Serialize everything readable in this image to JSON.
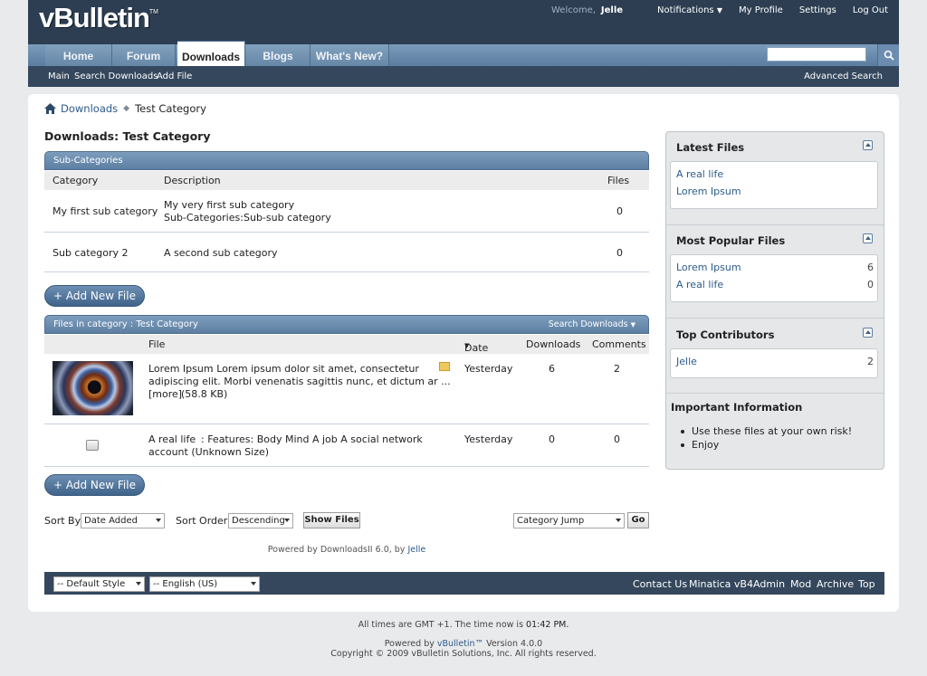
{
  "header": {
    "logo": "vBulletin",
    "logo_tm": "TM",
    "welcome": "Welcome,",
    "username": "Jelle",
    "links": {
      "notifications": "Notifications",
      "my_profile": "My Profile",
      "settings": "Settings",
      "logout": "Log Out"
    }
  },
  "nav": {
    "tabs": [
      "Home",
      "Forum",
      "Downloads",
      "Blogs",
      "What's New?"
    ],
    "active_tab": "Downloads",
    "subnav": [
      "Main",
      "Search Downloads",
      "Add File"
    ],
    "advanced_search": "Advanced Search",
    "search_placeholder": ""
  },
  "breadcrumb": {
    "root": "Downloads",
    "current": "Test Category"
  },
  "page_title": "Downloads: Test Category",
  "subcategories": {
    "header": "Sub-Categories",
    "columns": {
      "category": "Category",
      "description": "Description",
      "files": "Files"
    },
    "rows": [
      {
        "name": "My first sub category",
        "description": "My very first sub category",
        "subcat_label": "Sub-Categories:",
        "subcat_link": "Sub-sub category",
        "files": "0"
      },
      {
        "name": "Sub category 2",
        "description": "A second sub category",
        "files": "0"
      }
    ]
  },
  "add_file_label": "+ Add New File",
  "files": {
    "header": "Files in category : Test Category",
    "search_label": "Search Downloads",
    "columns": {
      "file": "File",
      "date": "Date",
      "downloads": "Downloads",
      "comments": "Comments"
    },
    "rows": [
      {
        "title": "Lorem Ipsum",
        "line1": " : Lorem ipsum dolor sit amet, consectetur",
        "line2": "adipiscing elit. Morbi venenatis sagittis nunc, et dictum ar ...",
        "more": "[more]",
        "size": " (58.8 KB)",
        "date": "Yesterday",
        "downloads": "6",
        "comments": "2"
      },
      {
        "title": "A real life",
        "line1": " : Features: Body Mind A job A social network",
        "line2": "account (Unknown Size)",
        "date": "Yesterday",
        "downloads": "0",
        "comments": "0"
      }
    ]
  },
  "sort": {
    "sort_by_label": "Sort By",
    "sort_by_value": "Date Added",
    "sort_order_label": "Sort Order",
    "sort_order_value": "Descending",
    "show_files": "Show Files",
    "category_jump": "Category Jump",
    "go": "Go"
  },
  "powered_by": {
    "text": "Powered by DownloadsII 6.0, by",
    "author": "Jelle"
  },
  "footer": {
    "style_select": "-- Default Style",
    "language_select": "-- English (US)",
    "links": [
      "Contact Us",
      "Minatica vB4",
      "Admin",
      "Mod",
      "Archive",
      "Top"
    ]
  },
  "bottom": {
    "time_prefix": "All times are GMT +1. The time now is",
    "time_value": "01:42 PM.",
    "powered_prefix": "Powered by",
    "powered_link": "vBulletin™",
    "powered_suffix": "Version 4.0.0",
    "copyright": "Copyright © 2009 vBulletin Solutions, Inc. All rights reserved."
  },
  "sidebar": {
    "latest": {
      "title": "Latest Files",
      "items": [
        "A real life",
        "Lorem Ipsum"
      ]
    },
    "popular": {
      "title": "Most Popular Files",
      "items": [
        {
          "name": "Lorem Ipsum",
          "count": "6"
        },
        {
          "name": "A real life",
          "count": "0"
        }
      ]
    },
    "contributors": {
      "title": "Top Contributors",
      "items": [
        {
          "name": "Jelle",
          "count": "2"
        }
      ]
    },
    "info": {
      "title": "Important Information",
      "items": [
        "Use these files at your own risk!",
        "Enjoy"
      ]
    }
  },
  "colors": {
    "header_bg": "#2d3e52",
    "nav_blue": "#6a8bab",
    "link": "#2c5b8a",
    "button": "#4f7299"
  }
}
